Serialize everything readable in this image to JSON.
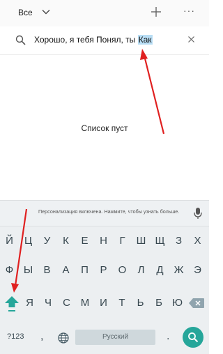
{
  "topbar": {
    "folder_label": "Все"
  },
  "search": {
    "text_before": "Хорошо, я тебя Понял, ты ",
    "text_selected": "Как"
  },
  "main": {
    "empty_text": "Список пуст"
  },
  "keyboard": {
    "suggestion": "Персонализация включена. Нажмите, чтобы узнать больше.",
    "row1": [
      "Й",
      "Ц",
      "У",
      "К",
      "Е",
      "Н",
      "Г",
      "Ш",
      "Щ",
      "З",
      "Х"
    ],
    "row2": [
      "Ф",
      "Ы",
      "В",
      "А",
      "П",
      "Р",
      "О",
      "Л",
      "Д",
      "Ж",
      "Э"
    ],
    "row3": [
      "Я",
      "Ч",
      "С",
      "М",
      "И",
      "Т",
      "Ь",
      "Б",
      "Ю"
    ],
    "symbols_label": "?123",
    "comma_label": ",",
    "space_label": "Русский",
    "period_label": "."
  },
  "colors": {
    "accent": "#26a69a",
    "selection": "#b9def5",
    "annotation_arrow": "#e02020"
  },
  "icons": [
    "chevron-down-icon",
    "plus-icon",
    "more-icon",
    "search-icon",
    "clear-icon",
    "mic-icon",
    "shift-icon",
    "backspace-icon",
    "globe-icon",
    "search-go-icon"
  ]
}
